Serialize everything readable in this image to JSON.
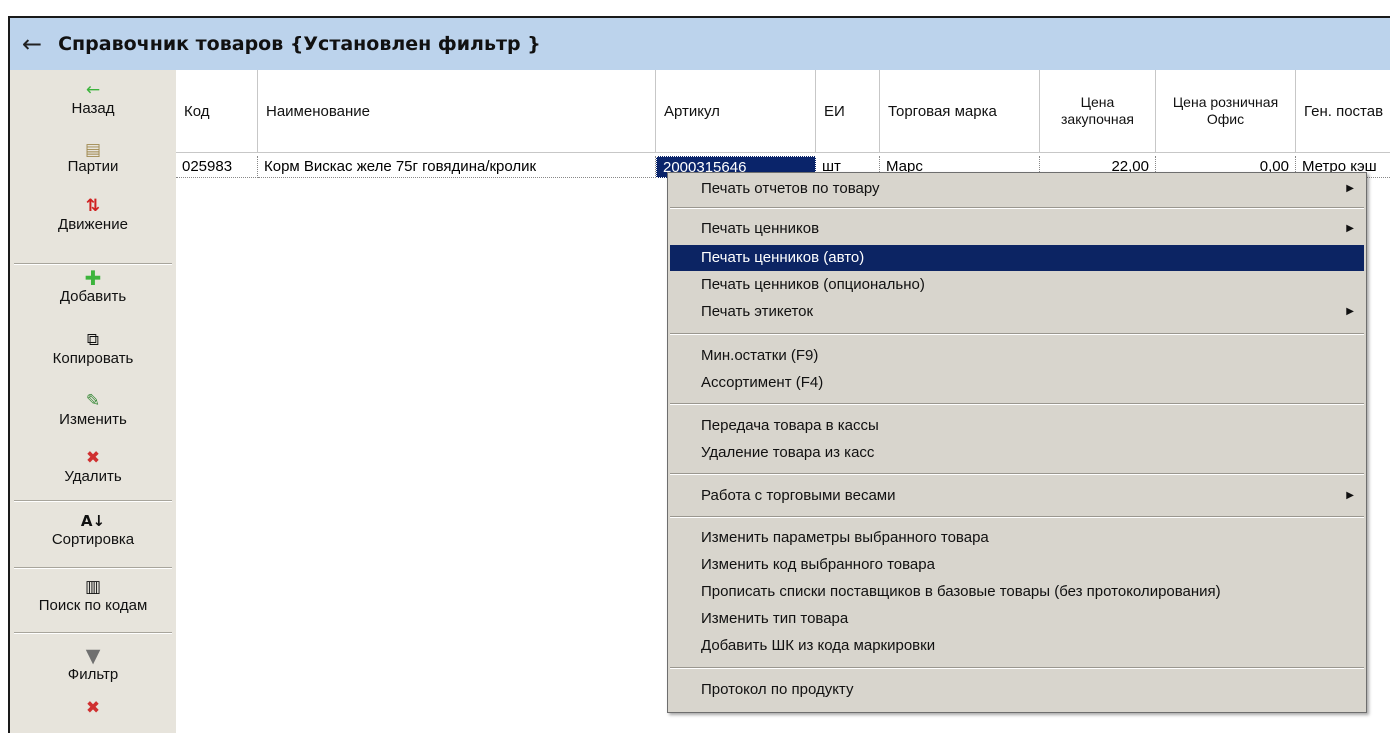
{
  "window": {
    "title": "Справочник товаров {Установлен фильтр }"
  },
  "sidebar": {
    "items": [
      {
        "label": "Назад",
        "icon": "←"
      },
      {
        "label": "Партии",
        "icon": "▤"
      },
      {
        "label": "Движение",
        "icon": "⇅"
      },
      {
        "label": "Добавить",
        "icon": "✚"
      },
      {
        "label": "Копировать",
        "icon": "⧉"
      },
      {
        "label": "Изменить",
        "icon": "✎"
      },
      {
        "label": "Удалить",
        "icon": "✖"
      },
      {
        "label": "Сортировка",
        "icon": "А↓"
      },
      {
        "label": "Поиск по кодам",
        "icon": "▥"
      },
      {
        "label": "Фильтр",
        "icon": "▼"
      },
      {
        "label": "",
        "icon": "✖"
      }
    ]
  },
  "grid": {
    "columns": [
      "Код",
      "Наименование",
      "Артикул",
      "ЕИ",
      "Торговая марка",
      "Цена закупочная",
      "Цена розничная Офис",
      "Ген. постав"
    ],
    "rows": [
      [
        "025983",
        "Корм Вискас желе 75г говядина/кролик",
        "2000315646",
        "шт",
        "Марс",
        "22,00",
        "0,00",
        "Метро кэш"
      ]
    ]
  },
  "context_menu": {
    "items": [
      "Печать отчетов по товару",
      "Печать ценников",
      "Печать ценников (авто)",
      "Печать ценников (опционально)",
      "Печать этикеток",
      "Мин.остатки (F9)",
      "Ассортимент (F4)",
      "Передача товара в кассы",
      "Удаление товара из касс",
      "Работа с торговыми весами",
      "Изменить параметры выбранного товара",
      "Изменить код выбранного товара",
      "Прописать списки поставщиков в базовые товары (без протоколирования)",
      "Изменить тип товара",
      "Добавить ШК из кода маркировки",
      "Протокол по продукту"
    ],
    "submenu_arrow": "▶",
    "highlighted": "Печать ценников (авто)"
  },
  "colors": {
    "title_bar": "#bcd3ec",
    "sidebar": "#e7e4dc",
    "menu_bg": "#d8d5cd",
    "menu_highlight": "#0c2463",
    "selection": "#0a246a",
    "add_icon": "#3cb43c",
    "delete_icon": "#d03030",
    "move_up": "#2a9a2a",
    "move_down": "#d02020"
  }
}
